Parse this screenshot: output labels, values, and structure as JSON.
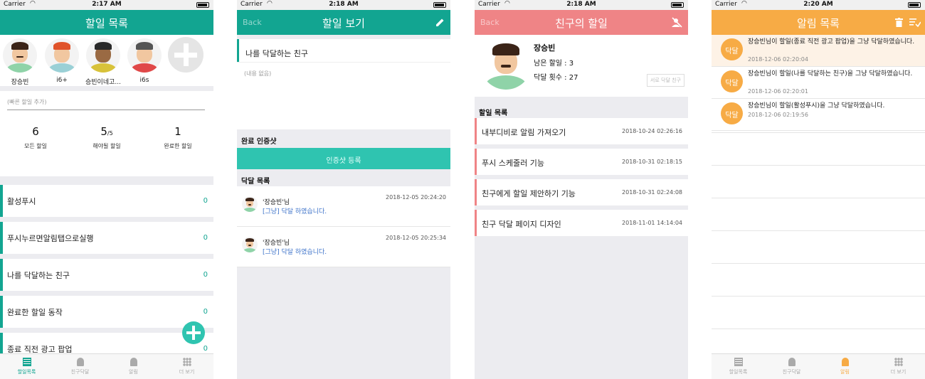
{
  "screens": {
    "todo_list": {
      "status": {
        "carrier": "Carrier",
        "time": "2:17 AM"
      },
      "title": "할일 목록",
      "friends": [
        {
          "name": "장승빈",
          "hair": "#3b2418",
          "shirt": "#8fd3a8",
          "mustache": true
        },
        {
          "name": "i6+",
          "hair": "#e0532a",
          "shirt": "#9ad0d6",
          "mustache": false
        },
        {
          "name": "승빈이네고...",
          "hair": "#2a2a2a",
          "shirt": "#d8c23a",
          "mustache": false
        },
        {
          "name": "i6s",
          "hair": "#555555",
          "shirt": "#e04848",
          "mustache": false
        }
      ],
      "quick_add_placeholder": "(빠른 할일 추가)",
      "stats": [
        {
          "num": "6",
          "denom": "",
          "label": "모든 할일"
        },
        {
          "num": "5",
          "denom": "/5",
          "label": "해야될 할일"
        },
        {
          "num": "1",
          "denom": "",
          "label": "완료한 할일"
        }
      ],
      "todos": [
        {
          "title": "활성푸시",
          "count": "0"
        },
        {
          "title": "푸시누르면알림탭으로실행",
          "count": "0"
        },
        {
          "title": "나를 닥달하는 친구",
          "count": "0"
        },
        {
          "title": "완료한 할일 동작",
          "count": "0"
        },
        {
          "title": "종료 직전 광고 팝업",
          "count": "0"
        }
      ],
      "tabs": [
        "할일목록",
        "친구닥달",
        "알림",
        "더 보기"
      ]
    },
    "todo_detail": {
      "status": {
        "carrier": "Carrier",
        "time": "2:18 AM"
      },
      "back": "Back",
      "title": "할일 보기",
      "todo_title": "나를 닥달하는 친구",
      "body": "(내용 없음)",
      "proof_header": "완료 인증샷",
      "proof_button": "인증샷 등록",
      "poke_header": "닥달 목록",
      "pokes": [
        {
          "who": "'장승빈'님",
          "msg": "[그냥] 닥달 하였습니다.",
          "date": "2018-12-05 20:24:20"
        },
        {
          "who": "'장승빈'님",
          "msg": "[그냥] 닥달 하였습니다.",
          "date": "2018-12-05 20:25:34"
        }
      ]
    },
    "friend_todo": {
      "status": {
        "carrier": "Carrier",
        "time": "2:18 AM"
      },
      "back": "Back",
      "title": "친구의 할일",
      "name": "장승빈",
      "remaining": "남은 할일 : 3",
      "poke_count": "닥달 횟수 : 27",
      "mutual_button": "서로 닥달 친구",
      "list_header": "할일 목록",
      "todos": [
        {
          "title": "내부디비로 알림 가져오기",
          "date": "2018-10-24 02:26:16"
        },
        {
          "title": "푸시 스케줄러 기능",
          "date": "2018-10-31 02:18:15"
        },
        {
          "title": "친구에게 할일 제안하기 기능",
          "date": "2018-10-31 02:24:08"
        },
        {
          "title": "친구 닥달 페이지 디자인",
          "date": "2018-11-01 14:14:04"
        }
      ]
    },
    "alerts": {
      "status": {
        "carrier": "Carrier",
        "time": "2:20 AM"
      },
      "title": "알림 목록",
      "badge_text": "닥달",
      "items": [
        {
          "text": "장승빈님이 할일(종료 직전 광고 팝업)을 그냥 닥달하였습니다.",
          "date": "2018-12-06 02:20:04",
          "highlight": true
        },
        {
          "text": "장승빈님이 할일(나를 닥달하는 친구)을 그냥 닥달하였습니다.",
          "date": "2018-12-06 02:20:01",
          "highlight": false
        },
        {
          "text": "장승빈님이 할일(활성푸시)을 그냥 닥달하였습니다.",
          "date": "2018-12-06 02:19:56",
          "highlight": false
        }
      ],
      "tabs": [
        "할일목록",
        "친구닥달",
        "알림",
        "더 보기"
      ]
    }
  },
  "colors": {
    "teal": "#12a591",
    "red": "#ef8486",
    "orange": "#f7ab45",
    "link_blue": "#3c72c9"
  }
}
